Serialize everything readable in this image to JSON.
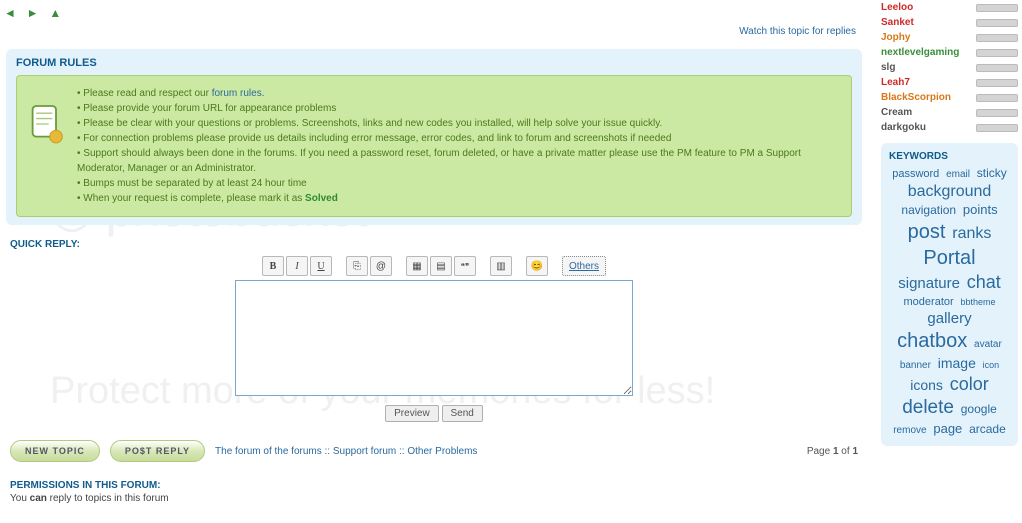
{
  "watch_link": "Watch this topic for replies",
  "forum_rules_title": "FORUM RULES",
  "rules": {
    "r0": "• Please read and respect our ",
    "r0link": "forum rules.",
    "r1": "• Please provide your forum URL for appearance problems",
    "r2": "• Please be clear with your questions or problems. Screenshots, links and new codes you installed, will help solve your issue quickly.",
    "r3": "• For connection problems please provide us details including error message, error codes, and link to forum and screenshots if needed",
    "r4": "• Support should always been done in the forums. If you need a password reset, forum deleted, or have a private matter please use the PM feature to PM a Support Moderator, Manager or an Administrator.",
    "r5": "• Bumps must be separated by at least 24 hour time",
    "r6a": "• When your request is complete, please mark it as ",
    "r6b": "Solved"
  },
  "quick_reply": "QUICK REPLY:",
  "toolbar": {
    "b": "B",
    "i": "I",
    "u": "U",
    "at": "@",
    "others": "Others"
  },
  "preview": "Preview",
  "send": "Send",
  "new_topic": "NEW TOPIC",
  "post_reply": "PO$T REPLY",
  "crumbs": {
    "a": "The forum of the forums",
    "b": "Support forum",
    "c": "Other Problems",
    "sep": " :: "
  },
  "pager": {
    "pre": "Page ",
    "cur": "1",
    "mid": " of ",
    "tot": "1"
  },
  "perm_title": "PERMISSIONS IN THIS FORUM:",
  "perm_text_a": "You ",
  "perm_text_b": "can",
  "perm_text_c": " reply to topics in this forum",
  "users": [
    {
      "name": "Leeloo",
      "cls": "u-red"
    },
    {
      "name": "Sanket",
      "cls": "u-red"
    },
    {
      "name": "Jophy",
      "cls": "u-org"
    },
    {
      "name": "nextlevelgaming",
      "cls": "u-grn"
    },
    {
      "name": "slg",
      "cls": "u-blk"
    },
    {
      "name": "Leah7",
      "cls": "u-red"
    },
    {
      "name": "BlackScorpion",
      "cls": "u-org"
    },
    {
      "name": "Cream",
      "cls": "u-blk"
    },
    {
      "name": "darkgoku",
      "cls": "u-blk"
    }
  ],
  "keywords_title": "KEYWORDS",
  "tags": [
    {
      "t": "password",
      "s": 11
    },
    {
      "t": "email",
      "s": 10
    },
    {
      "t": "sticky",
      "s": 12
    },
    {
      "t": "background",
      "s": 16
    },
    {
      "t": "navigation",
      "s": 12
    },
    {
      "t": "points",
      "s": 13
    },
    {
      "t": "post",
      "s": 20
    },
    {
      "t": "ranks",
      "s": 16
    },
    {
      "t": "Portal",
      "s": 20
    },
    {
      "t": "signature",
      "s": 15
    },
    {
      "t": "chat",
      "s": 18
    },
    {
      "t": "moderator",
      "s": 11
    },
    {
      "t": "bbtheme",
      "s": 9
    },
    {
      "t": "gallery",
      "s": 15
    },
    {
      "t": "chatbox",
      "s": 20
    },
    {
      "t": "avatar",
      "s": 10
    },
    {
      "t": "banner",
      "s": 10
    },
    {
      "t": "image",
      "s": 14
    },
    {
      "t": "icon",
      "s": 9
    },
    {
      "t": "icons",
      "s": 14
    },
    {
      "t": "color",
      "s": 18
    },
    {
      "t": "delete",
      "s": 19
    },
    {
      "t": "google",
      "s": 12
    },
    {
      "t": "remove",
      "s": 10
    },
    {
      "t": "page",
      "s": 13
    },
    {
      "t": "arcade",
      "s": 12
    }
  ]
}
